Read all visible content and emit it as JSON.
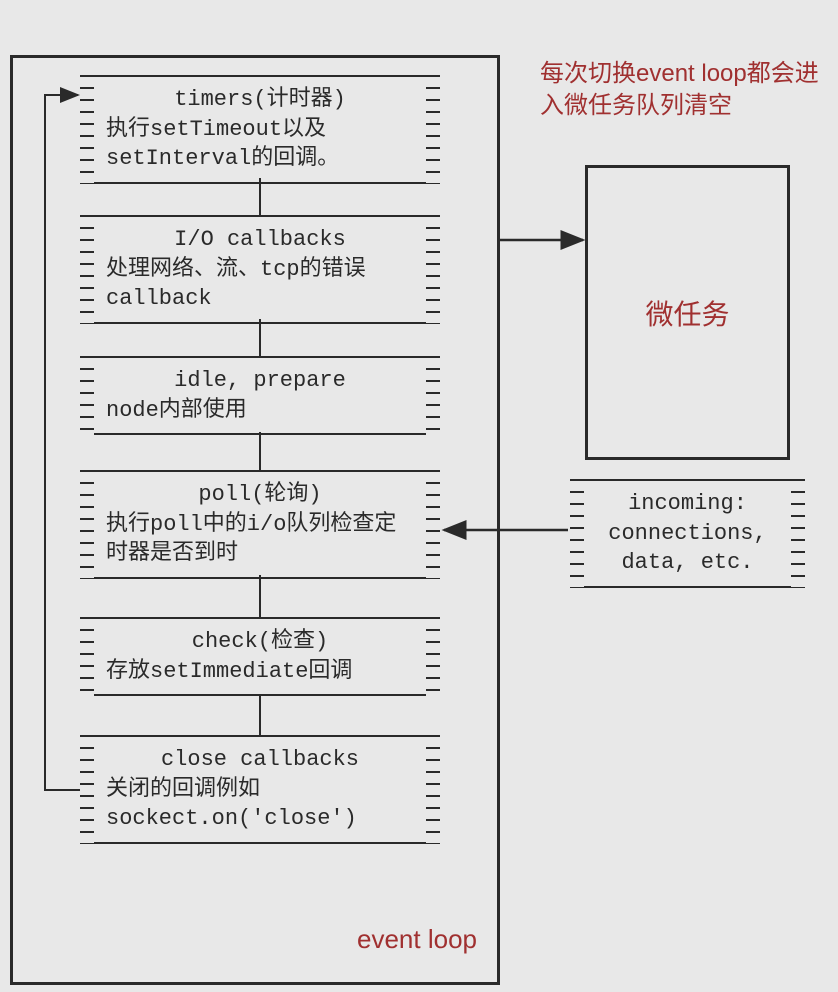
{
  "phases": [
    {
      "title": "timers(计时器)",
      "desc": "执行setTimeout以及setInterval的回调。"
    },
    {
      "title": "I/O callbacks",
      "desc": "处理网络、流、tcp的错误callback"
    },
    {
      "title": "idle, prepare",
      "desc": "node内部使用"
    },
    {
      "title": "poll(轮询)",
      "desc": "执行poll中的i/o队列检查定时器是否到时"
    },
    {
      "title": "check(检查)",
      "desc": "存放setImmediate回调"
    },
    {
      "title": "close callbacks",
      "desc": "关闭的回调例如sockect.on('close')"
    }
  ],
  "microtask_note": "每次切换event loop都会进入微任务队列清空",
  "microtask_label": "微任务",
  "incoming": {
    "line1": "incoming:",
    "line2": "connections,",
    "line3": "data, etc."
  },
  "event_loop_label": "event loop"
}
